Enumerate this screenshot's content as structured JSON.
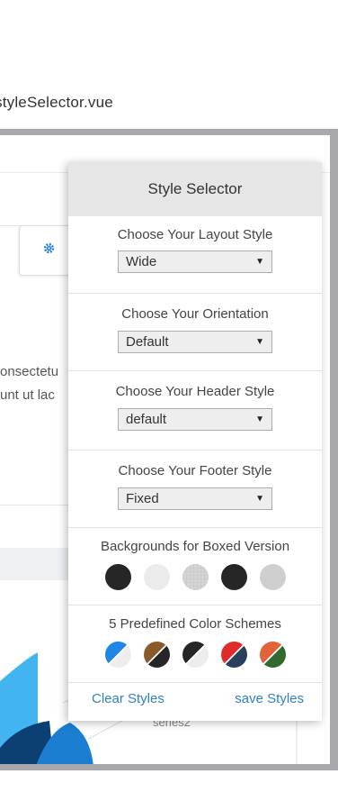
{
  "file_tab": {
    "name": "styleSelector.vue"
  },
  "background": {
    "text_lines": [
      "onsectetu",
      "unt ut lac"
    ],
    "chart_series_label": "series2",
    "accent_colors": {
      "light_blue": "#42b4f0",
      "mid_blue": "#1a7fd0",
      "dark_blue": "#0c3f73"
    }
  },
  "style_selector": {
    "title": "Style Selector",
    "layout": {
      "label": "Choose Your Layout Style",
      "value": "Wide"
    },
    "orientation": {
      "label": "Choose Your Orientation",
      "value": "Default"
    },
    "header": {
      "label": "Choose Your Header Style",
      "value": "default"
    },
    "footer": {
      "label": "Choose Your Footer Style",
      "value": "Fixed"
    },
    "backgrounds": {
      "label": "Backgrounds for Boxed Version",
      "swatches": [
        "#262626",
        "#ebebeb",
        "#d5d5d5",
        "#262626",
        "#cfcfcf"
      ]
    },
    "color_schemes": {
      "label": "5 Predefined Color Schemes",
      "schemes": [
        {
          "primary": "#1f86e8",
          "secondary": "#ededed"
        },
        {
          "primary": "#8b5a2b",
          "secondary": "#262626"
        },
        {
          "primary": "#262626",
          "secondary": "#ededed"
        },
        {
          "primary": "#e02b2b",
          "secondary": "#2a3f5c"
        },
        {
          "primary": "#e2623a",
          "secondary": "#2f6b2f"
        }
      ]
    },
    "clear_label": "Clear Styles",
    "save_label": "save Styles"
  },
  "icons": {
    "settings_tab": "gear-icon",
    "select_arrow": "caret-down-icon"
  }
}
